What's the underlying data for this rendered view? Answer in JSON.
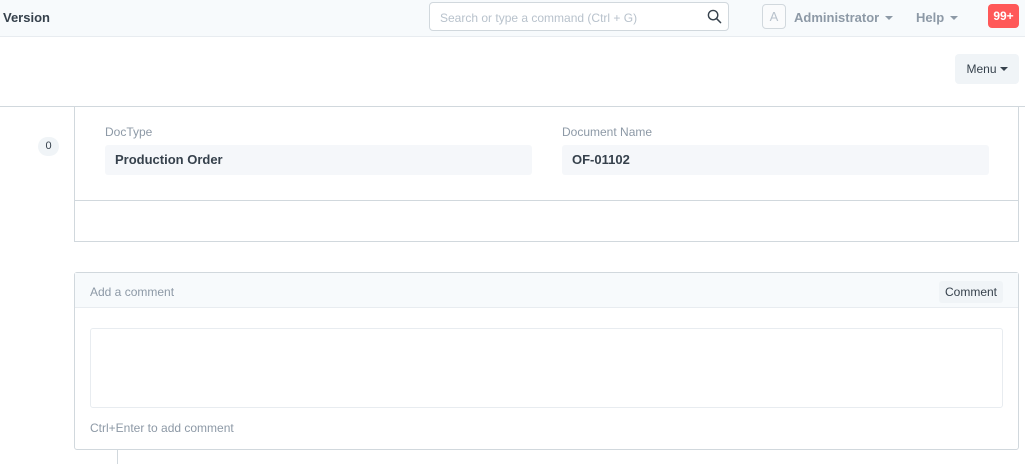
{
  "navbar": {
    "brand": "Version",
    "search_placeholder": "Search or type a command (Ctrl + G)",
    "avatar_letter": "A",
    "user_label": "Administrator",
    "help_label": "Help",
    "notification_count": "99+"
  },
  "page_head": {
    "menu_label": "Menu"
  },
  "sidebar": {
    "count": "0"
  },
  "form": {
    "doctype_label": "DocType",
    "doctype_value": "Production Order",
    "docname_label": "Document Name",
    "docname_value": "OF-01102"
  },
  "comments": {
    "title": "Add a comment",
    "button_label": "Comment",
    "input_value": "",
    "hint": "Ctrl+Enter to add comment"
  },
  "colors": {
    "notification_badge": "#ff5858",
    "navbar_bg": "#f7fafc",
    "field_bg": "#f5f7fa"
  },
  "icons": [
    "search-icon",
    "caret-down-icon"
  ]
}
